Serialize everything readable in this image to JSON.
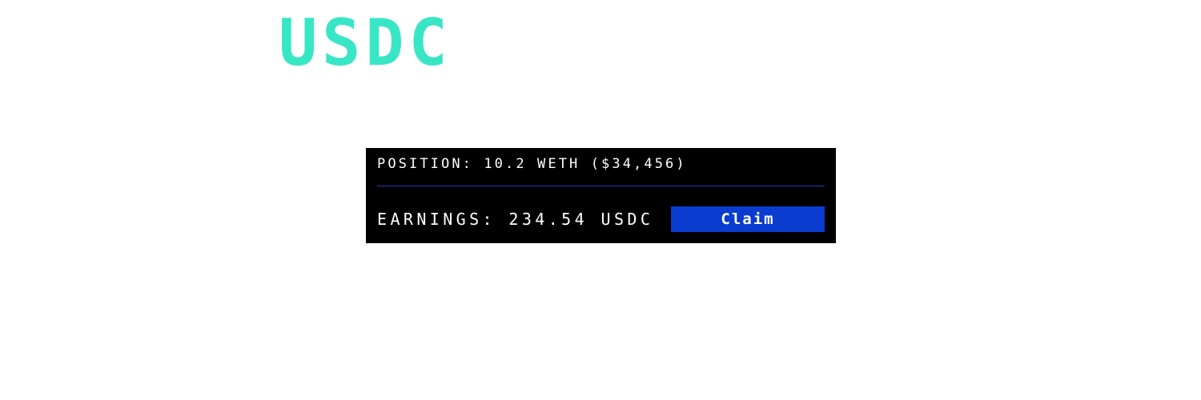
{
  "token": {
    "symbol": "USDC",
    "color": "#38e6c5"
  },
  "panel": {
    "position_text": "POSITION: 10.2 WETH ($34,456)",
    "earnings_text": "EARNINGS: 234.54 USDC",
    "claim_label": "Claim",
    "colors": {
      "background": "#000000",
      "divider": "#1d3fb8",
      "button": "#0a3ccf",
      "text": "#ffffff"
    }
  }
}
